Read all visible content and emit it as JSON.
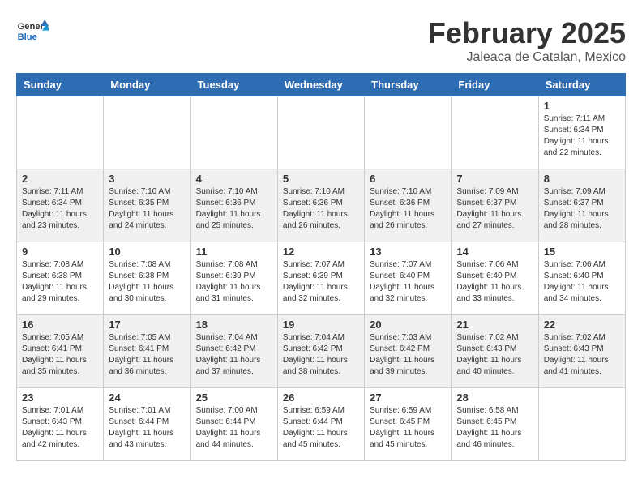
{
  "header": {
    "logo_general": "General",
    "logo_blue": "Blue",
    "month_year": "February 2025",
    "location": "Jaleaca de Catalan, Mexico"
  },
  "weekdays": [
    "Sunday",
    "Monday",
    "Tuesday",
    "Wednesday",
    "Thursday",
    "Friday",
    "Saturday"
  ],
  "weeks": [
    [
      {
        "day": "",
        "info": ""
      },
      {
        "day": "",
        "info": ""
      },
      {
        "day": "",
        "info": ""
      },
      {
        "day": "",
        "info": ""
      },
      {
        "day": "",
        "info": ""
      },
      {
        "day": "",
        "info": ""
      },
      {
        "day": "1",
        "info": "Sunrise: 7:11 AM\nSunset: 6:34 PM\nDaylight: 11 hours\nand 22 minutes."
      }
    ],
    [
      {
        "day": "2",
        "info": "Sunrise: 7:11 AM\nSunset: 6:34 PM\nDaylight: 11 hours\nand 23 minutes."
      },
      {
        "day": "3",
        "info": "Sunrise: 7:10 AM\nSunset: 6:35 PM\nDaylight: 11 hours\nand 24 minutes."
      },
      {
        "day": "4",
        "info": "Sunrise: 7:10 AM\nSunset: 6:36 PM\nDaylight: 11 hours\nand 25 minutes."
      },
      {
        "day": "5",
        "info": "Sunrise: 7:10 AM\nSunset: 6:36 PM\nDaylight: 11 hours\nand 26 minutes."
      },
      {
        "day": "6",
        "info": "Sunrise: 7:10 AM\nSunset: 6:36 PM\nDaylight: 11 hours\nand 26 minutes."
      },
      {
        "day": "7",
        "info": "Sunrise: 7:09 AM\nSunset: 6:37 PM\nDaylight: 11 hours\nand 27 minutes."
      },
      {
        "day": "8",
        "info": "Sunrise: 7:09 AM\nSunset: 6:37 PM\nDaylight: 11 hours\nand 28 minutes."
      }
    ],
    [
      {
        "day": "9",
        "info": "Sunrise: 7:08 AM\nSunset: 6:38 PM\nDaylight: 11 hours\nand 29 minutes."
      },
      {
        "day": "10",
        "info": "Sunrise: 7:08 AM\nSunset: 6:38 PM\nDaylight: 11 hours\nand 30 minutes."
      },
      {
        "day": "11",
        "info": "Sunrise: 7:08 AM\nSunset: 6:39 PM\nDaylight: 11 hours\nand 31 minutes."
      },
      {
        "day": "12",
        "info": "Sunrise: 7:07 AM\nSunset: 6:39 PM\nDaylight: 11 hours\nand 32 minutes."
      },
      {
        "day": "13",
        "info": "Sunrise: 7:07 AM\nSunset: 6:40 PM\nDaylight: 11 hours\nand 32 minutes."
      },
      {
        "day": "14",
        "info": "Sunrise: 7:06 AM\nSunset: 6:40 PM\nDaylight: 11 hours\nand 33 minutes."
      },
      {
        "day": "15",
        "info": "Sunrise: 7:06 AM\nSunset: 6:40 PM\nDaylight: 11 hours\nand 34 minutes."
      }
    ],
    [
      {
        "day": "16",
        "info": "Sunrise: 7:05 AM\nSunset: 6:41 PM\nDaylight: 11 hours\nand 35 minutes."
      },
      {
        "day": "17",
        "info": "Sunrise: 7:05 AM\nSunset: 6:41 PM\nDaylight: 11 hours\nand 36 minutes."
      },
      {
        "day": "18",
        "info": "Sunrise: 7:04 AM\nSunset: 6:42 PM\nDaylight: 11 hours\nand 37 minutes."
      },
      {
        "day": "19",
        "info": "Sunrise: 7:04 AM\nSunset: 6:42 PM\nDaylight: 11 hours\nand 38 minutes."
      },
      {
        "day": "20",
        "info": "Sunrise: 7:03 AM\nSunset: 6:42 PM\nDaylight: 11 hours\nand 39 minutes."
      },
      {
        "day": "21",
        "info": "Sunrise: 7:02 AM\nSunset: 6:43 PM\nDaylight: 11 hours\nand 40 minutes."
      },
      {
        "day": "22",
        "info": "Sunrise: 7:02 AM\nSunset: 6:43 PM\nDaylight: 11 hours\nand 41 minutes."
      }
    ],
    [
      {
        "day": "23",
        "info": "Sunrise: 7:01 AM\nSunset: 6:43 PM\nDaylight: 11 hours\nand 42 minutes."
      },
      {
        "day": "24",
        "info": "Sunrise: 7:01 AM\nSunset: 6:44 PM\nDaylight: 11 hours\nand 43 minutes."
      },
      {
        "day": "25",
        "info": "Sunrise: 7:00 AM\nSunset: 6:44 PM\nDaylight: 11 hours\nand 44 minutes."
      },
      {
        "day": "26",
        "info": "Sunrise: 6:59 AM\nSunset: 6:44 PM\nDaylight: 11 hours\nand 45 minutes."
      },
      {
        "day": "27",
        "info": "Sunrise: 6:59 AM\nSunset: 6:45 PM\nDaylight: 11 hours\nand 45 minutes."
      },
      {
        "day": "28",
        "info": "Sunrise: 6:58 AM\nSunset: 6:45 PM\nDaylight: 11 hours\nand 46 minutes."
      },
      {
        "day": "",
        "info": ""
      }
    ]
  ]
}
